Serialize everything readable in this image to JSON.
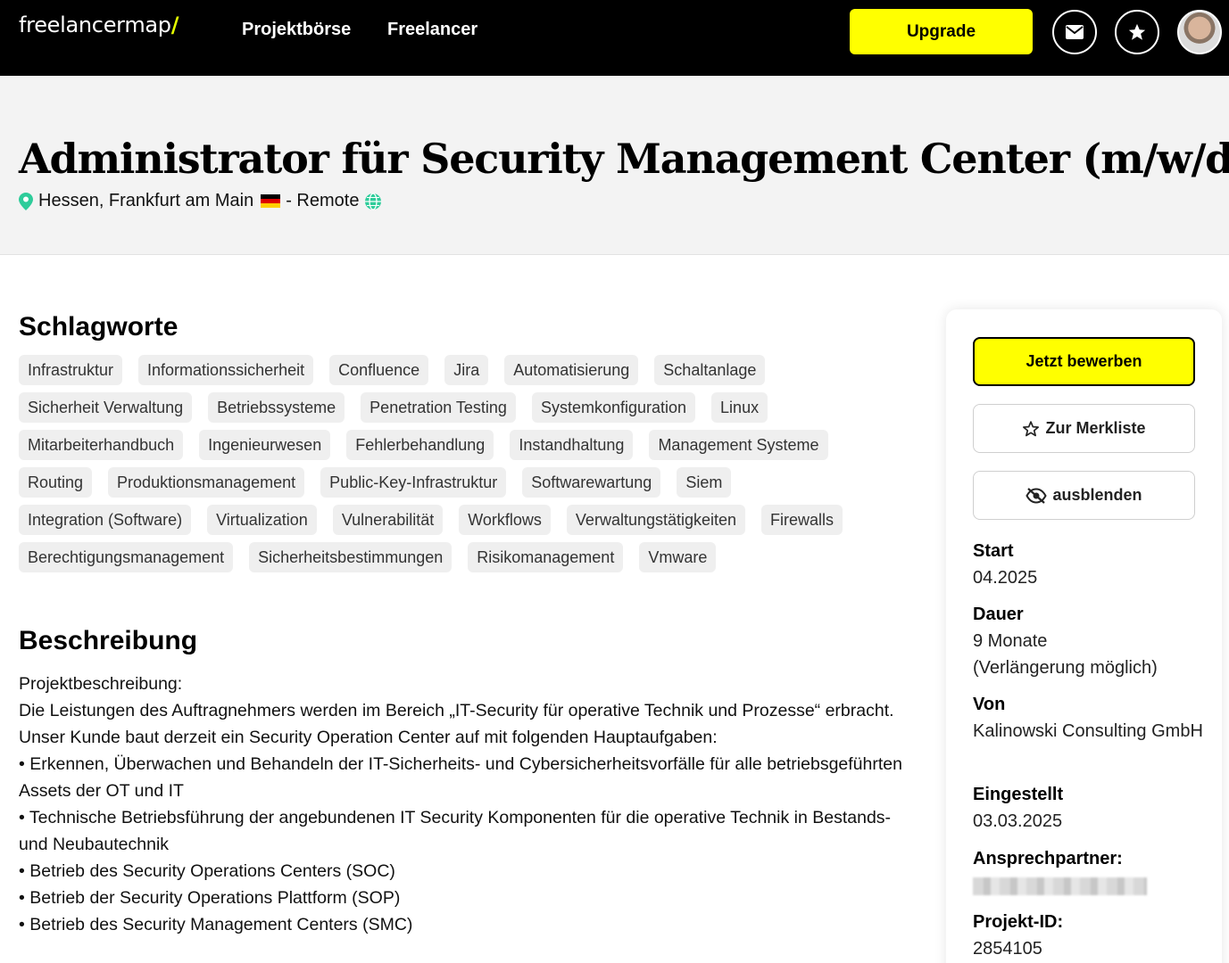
{
  "nav": {
    "logo_main": "freelancermap",
    "logo_slash": "/",
    "projects": "Projektbörse",
    "freelancer": "Freelancer",
    "upgrade": "Upgrade"
  },
  "icons": [
    "envelope-icon",
    "star-icon",
    "map-pin-icon",
    "globe-icon",
    "star-outline-icon",
    "eye-slash-icon"
  ],
  "colors": {
    "accent": "#ffff00",
    "topbar": "#000000",
    "location_pin": "#2ecc9a"
  },
  "project": {
    "title": "Administrator für Security Management Center (m/w/d)",
    "location": "Hessen, Frankfurt am Main",
    "remote": "- Remote"
  },
  "sections": {
    "tags_title": "Schlagworte",
    "desc_title": "Beschreibung"
  },
  "tags": [
    "Infrastruktur",
    "Informationssicherheit",
    "Confluence",
    "Jira",
    "Automatisierung",
    "Schaltanlage",
    "Sicherheit Verwaltung",
    "Betriebssysteme",
    "Penetration Testing",
    "Systemkonfiguration",
    "Linux",
    "Mitarbeiterhandbuch",
    "Ingenieurwesen",
    "Fehlerbehandlung",
    "Instandhaltung",
    "Management Systeme",
    "Routing",
    "Produktionsmanagement",
    "Public-Key-Infrastruktur",
    "Softwarewartung",
    "Siem",
    "Integration (Software)",
    "Virtualization",
    "Vulnerabilität",
    "Workflows",
    "Verwaltungstätigkeiten",
    "Firewalls",
    "Berechtigungsmanagement",
    "Sicherheitsbestimmungen",
    "Risikomanagement",
    "Vmware"
  ],
  "description": [
    "Projektbeschreibung:",
    "Die Leistungen des Auftragnehmers werden im Bereich „IT-Security für operative Technik und Prozesse“ erbracht.",
    "Unser Kunde baut derzeit ein Security Operation Center auf mit folgenden Hauptaufgaben:",
    "• Erkennen, Überwachen und Behandeln der IT-Sicherheits- und Cybersicherheitsvorfälle für alle betriebsgeführten Assets der OT und IT",
    "• Technische Betriebsführung der angebundenen IT Security Komponenten für die operative Technik in Bestands- und Neubautechnik",
    "• Betrieb des Security Operations Centers (SOC)",
    "• Betrieb der Security Operations Plattform (SOP)",
    "• Betrieb des Security Management Centers (SMC)"
  ],
  "sidebar": {
    "apply": "Jetzt bewerben",
    "watchlist": "Zur Merkliste",
    "hide": "ausblenden",
    "start_label": "Start",
    "start_value": "04.2025",
    "duration_label": "Dauer",
    "duration_value": "9 Monate",
    "duration_note": "(Verlängerung möglich)",
    "from_label": "Von",
    "from_value": "Kalinowski Consulting GmbH",
    "posted_label": "Eingestellt",
    "posted_value": "03.03.2025",
    "contact_label": "Ansprechpartner:",
    "id_label": "Projekt-ID:",
    "id_value": "2854105"
  }
}
